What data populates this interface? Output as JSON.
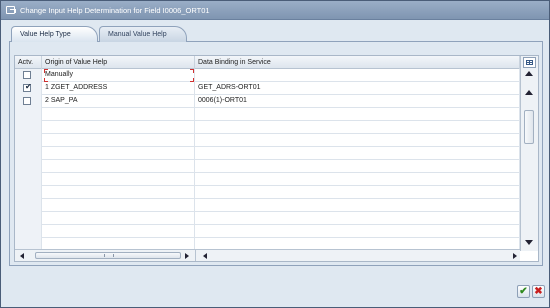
{
  "window": {
    "title": "Change Input Help Determination for Field I0006_ORT01"
  },
  "tabs": [
    {
      "label": "Value Help Type",
      "active": true
    },
    {
      "label": "Manual Value Help",
      "active": false
    }
  ],
  "table": {
    "columns": [
      "Actv.",
      "Origin of Value Help",
      "Data Binding in Service"
    ],
    "rows": [
      {
        "active": false,
        "origin": "Manually",
        "binding": ""
      },
      {
        "active": true,
        "origin": "1 ZGET_ADDRESS",
        "binding": "GET_ADRS-ORT01"
      },
      {
        "active": false,
        "origin": "2 SAP_PA",
        "binding": "0006(1)-ORT01"
      }
    ]
  },
  "icons": {
    "title": "window-edit-icon",
    "settings": "table-settings-icon",
    "ok": "checkmark-icon",
    "cancel": "cancel-x-icon"
  },
  "colors": {
    "ok": "#2f8a1f",
    "cancel": "#c81f1f",
    "focus": "#d03030"
  }
}
